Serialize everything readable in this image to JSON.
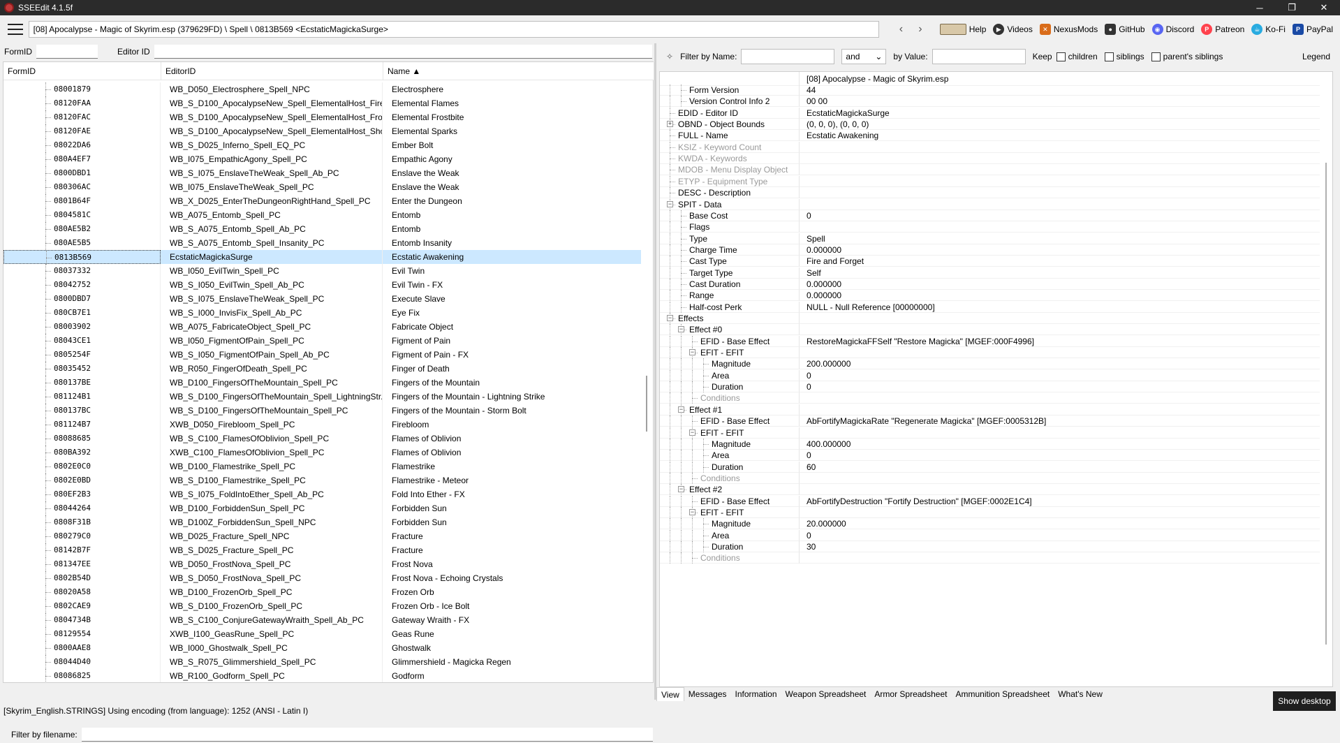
{
  "window": {
    "title": "SSEEdit 4.1.5f",
    "minimize": "─",
    "maximize": "❐",
    "close": "✕"
  },
  "toolbar": {
    "path": "[08] Apocalypse - Magic of Skyrim.esp (379629FD) \\ Spell \\ 0813B569 <EcstaticMagickaSurge>",
    "back": "‹",
    "forward": "›",
    "links": [
      "Help",
      "Videos",
      "NexusMods",
      "GitHub",
      "Discord",
      "Patreon",
      "Ko-Fi",
      "PayPal"
    ]
  },
  "left": {
    "formid_label": "FormID",
    "editorid_label": "Editor ID",
    "columns": [
      "FormID",
      "EditorID",
      "Name ▲"
    ],
    "rows": [
      [
        "08001879",
        "WB_D050_Electrosphere_Spell_NPC",
        "Electrosphere"
      ],
      [
        "08120FAA",
        "WB_S_D100_ApocalypseNew_Spell_ElementalHost_Fire...",
        "Elemental Flames"
      ],
      [
        "08120FAC",
        "WB_S_D100_ApocalypseNew_Spell_ElementalHost_Fro...",
        "Elemental Frostbite"
      ],
      [
        "08120FAE",
        "WB_S_D100_ApocalypseNew_Spell_ElementalHost_Sho...",
        "Elemental Sparks"
      ],
      [
        "08022DA6",
        "WB_S_D025_Inferno_Spell_EQ_PC",
        "Ember Bolt"
      ],
      [
        "080A4EF7",
        "WB_I075_EmpathicAgony_Spell_PC",
        "Empathic Agony"
      ],
      [
        "0800DBD1",
        "WB_S_I075_EnslaveTheWeak_Spell_Ab_PC",
        "Enslave the Weak"
      ],
      [
        "080306AC",
        "WB_I075_EnslaveTheWeak_Spell_PC",
        "Enslave the Weak"
      ],
      [
        "0801B64F",
        "WB_X_D025_EnterTheDungeonRightHand_Spell_PC",
        "Enter the Dungeon"
      ],
      [
        "0804581C",
        "WB_A075_Entomb_Spell_PC",
        "Entomb"
      ],
      [
        "080AE5B2",
        "WB_S_A075_Entomb_Spell_Ab_PC",
        "Entomb"
      ],
      [
        "080AE5B5",
        "WB_S_A075_Entomb_Spell_Insanity_PC",
        "Entomb Insanity"
      ],
      [
        "0813B569",
        "EcstaticMagickaSurge",
        "Ecstatic Awakening"
      ],
      [
        "08037332",
        "WB_I050_EvilTwin_Spell_PC",
        "Evil Twin"
      ],
      [
        "08042752",
        "WB_S_I050_EvilTwin_Spell_Ab_PC",
        "Evil Twin - FX"
      ],
      [
        "0800DBD7",
        "WB_S_I075_EnslaveTheWeak_Spell_PC",
        "Execute Slave"
      ],
      [
        "080CB7E1",
        "WB_S_I000_InvisFix_Spell_Ab_PC",
        "Eye Fix"
      ],
      [
        "08003902",
        "WB_A075_FabricateObject_Spell_PC",
        "Fabricate Object"
      ],
      [
        "08043CE1",
        "WB_I050_FigmentOfPain_Spell_PC",
        "Figment of Pain"
      ],
      [
        "0805254F",
        "WB_S_I050_FigmentOfPain_Spell_Ab_PC",
        "Figment of Pain - FX"
      ],
      [
        "08035452",
        "WB_R050_FingerOfDeath_Spell_PC",
        "Finger of Death"
      ],
      [
        "080137BE",
        "WB_D100_FingersOfTheMountain_Spell_PC",
        "Fingers of the Mountain"
      ],
      [
        "081124B1",
        "WB_S_D100_FingersOfTheMountain_Spell_LightningStr...",
        "Fingers of the Mountain - Lightning Strike"
      ],
      [
        "080137BC",
        "WB_S_D100_FingersOfTheMountain_Spell_PC",
        "Fingers of the Mountain - Storm Bolt"
      ],
      [
        "081124B7",
        "XWB_D050_Firebloom_Spell_PC",
        "Firebloom"
      ],
      [
        "08088685",
        "WB_S_C100_FlamesOfOblivion_Spell_PC",
        "Flames of Oblivion"
      ],
      [
        "080BA392",
        "XWB_C100_FlamesOfOblivion_Spell_PC",
        "Flames of Oblivion"
      ],
      [
        "0802E0C0",
        "WB_D100_Flamestrike_Spell_PC",
        "Flamestrike"
      ],
      [
        "0802E0BD",
        "WB_S_D100_Flamestrike_Spell_PC",
        "Flamestrike - Meteor"
      ],
      [
        "080EF2B3",
        "WB_S_I075_FoldIntoEther_Spell_Ab_PC",
        "Fold Into Ether - FX"
      ],
      [
        "08044264",
        "WB_D100_ForbiddenSun_Spell_PC",
        "Forbidden Sun"
      ],
      [
        "0808F31B",
        "WB_D100Z_ForbiddenSun_Spell_NPC",
        "Forbidden Sun"
      ],
      [
        "080279C0",
        "WB_D025_Fracture_Spell_NPC",
        "Fracture"
      ],
      [
        "08142B7F",
        "WB_S_D025_Fracture_Spell_PC",
        "Fracture"
      ],
      [
        "081347EE",
        "WB_D050_FrostNova_Spell_PC",
        "Frost Nova"
      ],
      [
        "0802B54D",
        "WB_S_D050_FrostNova_Spell_PC",
        "Frost Nova - Echoing Crystals"
      ],
      [
        "08020A58",
        "WB_D100_FrozenOrb_Spell_PC",
        "Frozen Orb"
      ],
      [
        "0802CAE9",
        "WB_S_D100_FrozenOrb_Spell_PC",
        "Frozen Orb - Ice Bolt"
      ],
      [
        "0804734B",
        "WB_S_C100_ConjureGatewayWraith_Spell_Ab_PC",
        "Gateway Wraith - FX"
      ],
      [
        "08129554",
        "XWB_I100_GeasRune_Spell_PC",
        "Geas Rune"
      ],
      [
        "0800AAE8",
        "WB_I000_Ghostwalk_Spell_PC",
        "Ghostwalk"
      ],
      [
        "08044D40",
        "WB_S_R075_Glimmershield_Spell_PC",
        "Glimmershield - Magicka Regen"
      ],
      [
        "08086825",
        "WB_R100_Godform_Spell_PC",
        "Godform"
      ]
    ],
    "filename_label": "Filter by filename:"
  },
  "right": {
    "filter_name_label": "Filter by Name:",
    "and_value": "and",
    "filter_value_label": "by Value:",
    "keep_label": "Keep",
    "children_label": "children",
    "siblings_label": "siblings",
    "parents_label": "parent's siblings",
    "legend_label": "Legend",
    "header_value": "[08] Apocalypse - Magic of Skyrim.esp",
    "rows": [
      {
        "label": "Form Version",
        "value": "44",
        "indent": 1
      },
      {
        "label": "Version Control Info 2",
        "value": "00 00",
        "indent": 1
      },
      {
        "label": "EDID - Editor ID",
        "value": "EcstaticMagickaSurge",
        "indent": 0
      },
      {
        "label": "OBND - Object Bounds",
        "value": "(0, 0, 0), (0, 0, 0)",
        "indent": 0,
        "toggle": "+"
      },
      {
        "label": "FULL - Name",
        "value": "Ecstatic Awakening",
        "indent": 0
      },
      {
        "label": "KSIZ - Keyword Count",
        "value": "",
        "indent": 0,
        "dim": true
      },
      {
        "label": "KWDA - Keywords",
        "value": "",
        "indent": 0,
        "dim": true
      },
      {
        "label": "MDOB - Menu Display Object",
        "value": "",
        "indent": 0,
        "dim": true
      },
      {
        "label": "ETYP - Equipment Type",
        "value": "",
        "indent": 0,
        "dim": true
      },
      {
        "label": "DESC - Description",
        "value": "",
        "indent": 0
      },
      {
        "label": "SPIT - Data",
        "value": "",
        "indent": 0,
        "toggle": "-"
      },
      {
        "label": "Base Cost",
        "value": "0",
        "indent": 1
      },
      {
        "label": "Flags",
        "value": "",
        "indent": 1
      },
      {
        "label": "Type",
        "value": "Spell",
        "indent": 1
      },
      {
        "label": "Charge Time",
        "value": "0.000000",
        "indent": 1
      },
      {
        "label": "Cast Type",
        "value": "Fire and Forget",
        "indent": 1
      },
      {
        "label": "Target Type",
        "value": "Self",
        "indent": 1
      },
      {
        "label": "Cast Duration",
        "value": "0.000000",
        "indent": 1
      },
      {
        "label": "Range",
        "value": "0.000000",
        "indent": 1
      },
      {
        "label": "Half-cost Perk",
        "value": "NULL - Null Reference [00000000]",
        "indent": 1
      },
      {
        "label": "Effects",
        "value": "",
        "indent": 0,
        "toggle": "-"
      },
      {
        "label": "Effect #0",
        "value": "",
        "indent": 1,
        "toggle": "-"
      },
      {
        "label": "EFID - Base Effect",
        "value": "RestoreMagickaFFSelf \"Restore Magicka\" [MGEF:000F4996]",
        "indent": 2
      },
      {
        "label": "EFIT - EFIT",
        "value": "",
        "indent": 2,
        "toggle": "-"
      },
      {
        "label": "Magnitude",
        "value": "200.000000",
        "indent": 3
      },
      {
        "label": "Area",
        "value": "0",
        "indent": 3
      },
      {
        "label": "Duration",
        "value": "0",
        "indent": 3
      },
      {
        "label": "Conditions",
        "value": "",
        "indent": 2,
        "dim": true
      },
      {
        "label": "Effect #1",
        "value": "",
        "indent": 1,
        "toggle": "-"
      },
      {
        "label": "EFID - Base Effect",
        "value": "AbFortifyMagickaRate \"Regenerate Magicka\" [MGEF:0005312B]",
        "indent": 2
      },
      {
        "label": "EFIT - EFIT",
        "value": "",
        "indent": 2,
        "toggle": "-"
      },
      {
        "label": "Magnitude",
        "value": "400.000000",
        "indent": 3
      },
      {
        "label": "Area",
        "value": "0",
        "indent": 3
      },
      {
        "label": "Duration",
        "value": "60",
        "indent": 3
      },
      {
        "label": "Conditions",
        "value": "",
        "indent": 2,
        "dim": true
      },
      {
        "label": "Effect #2",
        "value": "",
        "indent": 1,
        "toggle": "-"
      },
      {
        "label": "EFID - Base Effect",
        "value": "AbFortifyDestruction \"Fortify Destruction\" [MGEF:0002E1C4]",
        "indent": 2
      },
      {
        "label": "EFIT - EFIT",
        "value": "",
        "indent": 2,
        "toggle": "-"
      },
      {
        "label": "Magnitude",
        "value": "20.000000",
        "indent": 3
      },
      {
        "label": "Area",
        "value": "0",
        "indent": 3
      },
      {
        "label": "Duration",
        "value": "30",
        "indent": 3
      },
      {
        "label": "Conditions",
        "value": "",
        "indent": 2,
        "dim": true
      }
    ],
    "tabs": [
      "View",
      "Messages",
      "Information",
      "Weapon Spreadsheet",
      "Armor Spreadsheet",
      "Ammunition Spreadsheet",
      "What's New"
    ]
  },
  "status": {
    "text": "[Skyrim_English.STRINGS] Using encoding (from language): 1252  (ANSI - Latin I)",
    "show_desktop": "Show desktop"
  },
  "selected_formid": "0813B569"
}
